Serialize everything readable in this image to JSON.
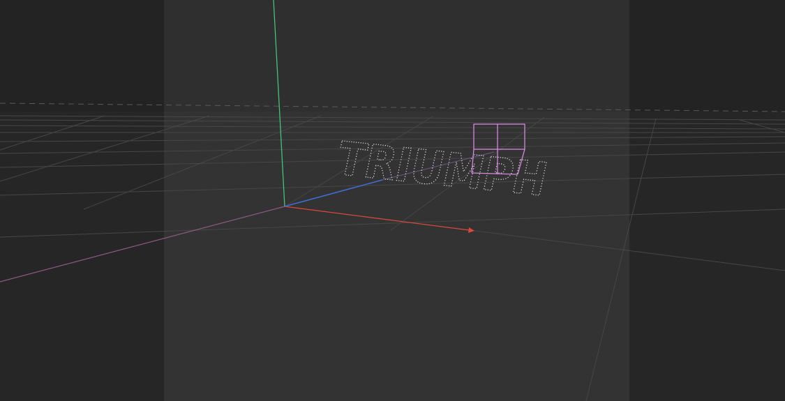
{
  "scene": {
    "point_cloud_text": "TRIUMPH",
    "colors": {
      "background": "#2a2a2a",
      "side_panel": "#252525",
      "center_region": "#323232",
      "grid": "#4a4a4a",
      "axis_x": "#d8483e",
      "axis_y": "#45c37a",
      "axis_z": "#3f6fd6",
      "axis_neg_x": "#8e5a86",
      "selection_box": "#d68ae0",
      "point_cloud": "#e6e6e6"
    }
  }
}
